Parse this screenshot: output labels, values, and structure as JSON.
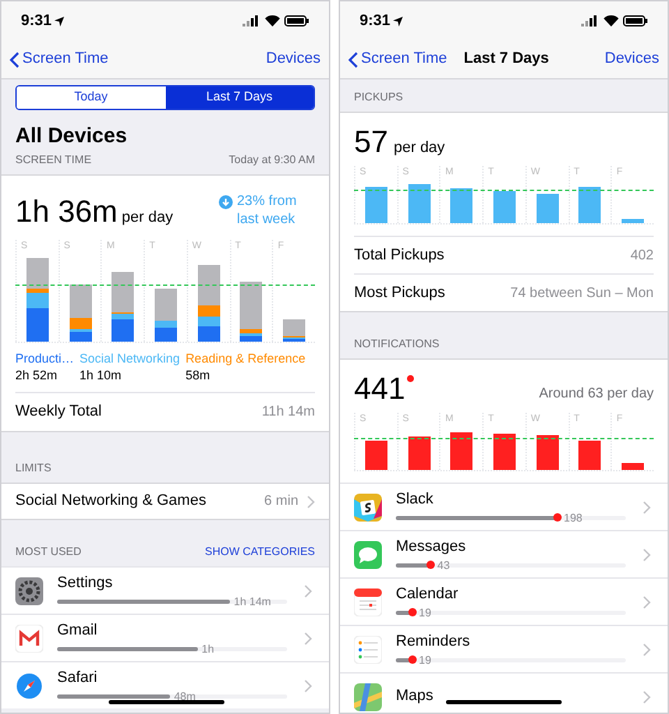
{
  "left_screen": {
    "status_bar": {
      "time": "9:31"
    },
    "nav": {
      "back": "Screen Time",
      "right": "Devices"
    },
    "segments": [
      {
        "label": "Today",
        "selected": false
      },
      {
        "label": "Last 7 Days",
        "selected": true
      }
    ],
    "title": "All Devices",
    "section_header": {
      "label": "SCREEN TIME",
      "date": "Today at 9:30 AM"
    },
    "summary": {
      "value": "1h 36m",
      "unit": "per day",
      "change": "23% from last week"
    },
    "days": [
      "S",
      "S",
      "M",
      "T",
      "W",
      "T",
      "F"
    ],
    "legend": [
      {
        "label": "Producti…",
        "value": "2h 52m",
        "color": "#1f6ff2"
      },
      {
        "label": "Social Networking",
        "value": "1h 10m",
        "color": "#4cb8f5"
      },
      {
        "label": "Reading & Reference",
        "value": "58m",
        "color": "#ff8a00"
      }
    ],
    "weekly_total": {
      "label": "Weekly Total",
      "value": "11h 14m"
    },
    "limits": {
      "header": "LIMITS",
      "rows": [
        {
          "label": "Social Networking & Games",
          "value": "6 min"
        }
      ]
    },
    "most_used": {
      "header": "MOST USED",
      "action": "SHOW CATEGORIES",
      "apps": [
        {
          "kind": "settings",
          "name": "Settings",
          "level": 0.75,
          "time": "1h 14m"
        },
        {
          "kind": "gmail",
          "name": "Gmail",
          "level": 0.61,
          "time": "1h"
        },
        {
          "kind": "safari",
          "name": "Safari",
          "level": 0.49,
          "time": "48m"
        }
      ]
    }
  },
  "right_screen": {
    "status_bar": {
      "time": "9:31"
    },
    "nav": {
      "back": "Screen Time",
      "title": "Last 7 Days",
      "right": "Devices"
    },
    "pickups": {
      "header": "PICKUPS",
      "value": "57",
      "unit": "per day",
      "days": [
        "S",
        "S",
        "M",
        "T",
        "W",
        "T",
        "F"
      ],
      "rows": [
        {
          "label": "Total Pickups",
          "value": "402"
        },
        {
          "label": "Most Pickups",
          "value": "74 between Sun – Mon"
        }
      ]
    },
    "notifications": {
      "header": "NOTIFICATIONS",
      "value": "441",
      "average": "Around 63 per day",
      "days": [
        "S",
        "S",
        "M",
        "T",
        "W",
        "T",
        "F"
      ],
      "apps": [
        {
          "kind": "slack",
          "name": "Slack",
          "level": 0.7,
          "count": "198"
        },
        {
          "kind": "messages",
          "name": "Messages",
          "level": 0.15,
          "count": "43"
        },
        {
          "kind": "calendar",
          "name": "Calendar",
          "level": 0.07,
          "count": "19"
        },
        {
          "kind": "reminders",
          "name": "Reminders",
          "level": 0.07,
          "count": "19"
        },
        {
          "kind": "maps",
          "name": "Maps"
        }
      ]
    }
  }
}
